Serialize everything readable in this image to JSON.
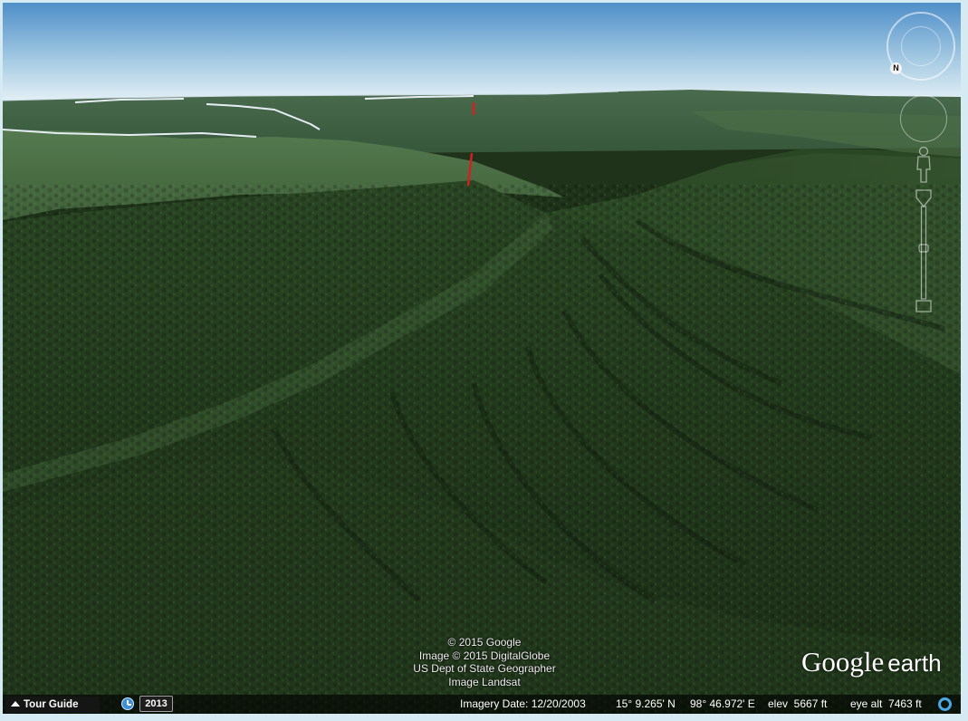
{
  "viewport": {
    "attribution": [
      "© 2015 Google",
      "Image © 2015 DigitalGlobe",
      "US Dept of State Geographer",
      "Image Landsat"
    ],
    "logo": {
      "word1": "Google",
      "word2": "earth"
    },
    "north_label": "N"
  },
  "status_bar": {
    "tour_guide_label": "Tour Guide",
    "year_label": "2013",
    "imagery_date": "Imagery Date: 12/20/2003",
    "latitude": "15° 9.265' N",
    "longitude": "98° 46.972' E",
    "elevation": "elev  5667 ft",
    "eye_alt": "eye alt  7463 ft"
  },
  "colors": {
    "sky_top": "#4f8fc9",
    "sky_horizon": "#e6f1f6",
    "forest_dark": "#1e3319",
    "forest_mid": "#2c4a25",
    "ridge_light": "#4d7045",
    "path_red": "#d42020",
    "river_white": "#e6eef4",
    "frame": "#d6eaf4",
    "accent_blue": "#4aa8e8"
  },
  "icons": {
    "look": "look-ring-icon",
    "move": "move-ring-icon",
    "street_view": "street-view-figure-icon",
    "zoom": "zoom-slider-icon",
    "tour_guide": "triangle-up-icon",
    "history": "history-clock-icon",
    "status": "streaming-indicator-icon"
  }
}
